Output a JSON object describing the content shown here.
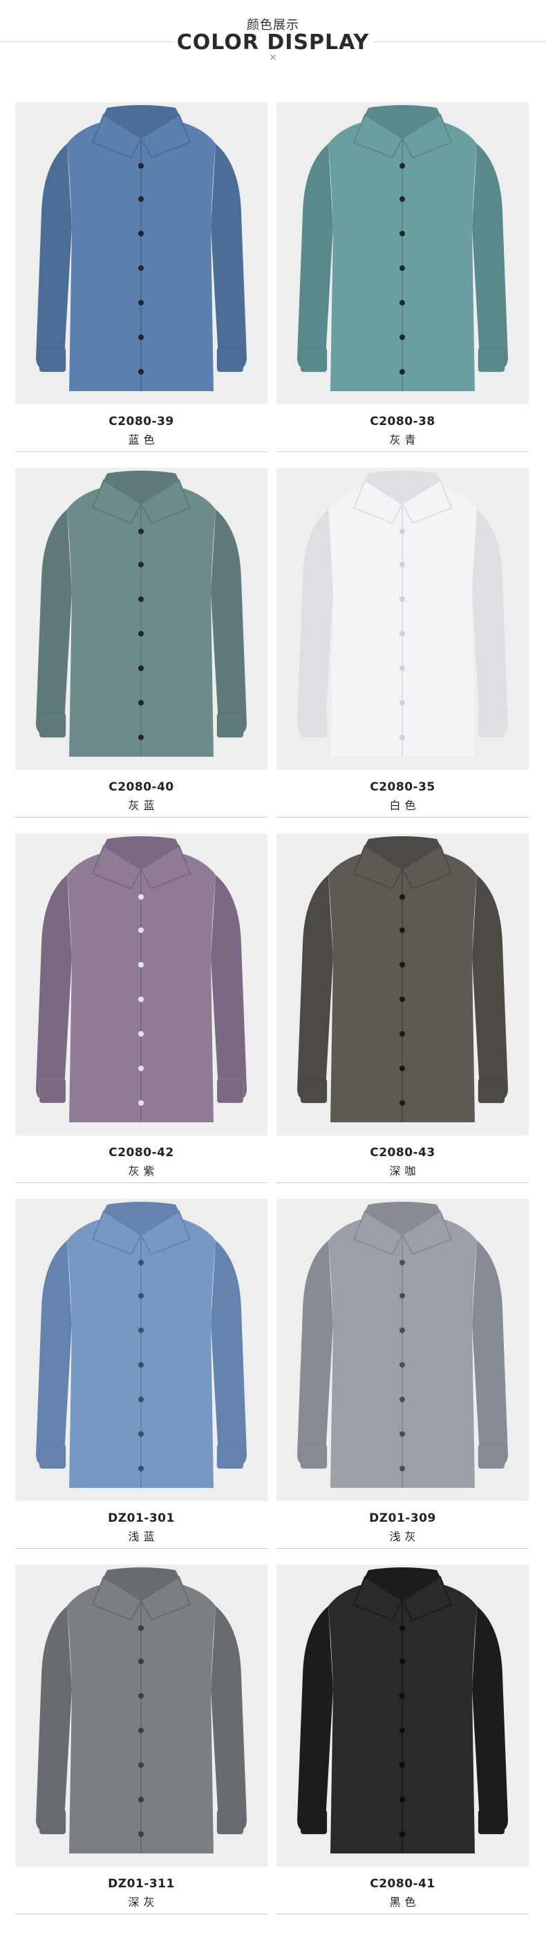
{
  "header": {
    "title_cn": "颜色展示",
    "title_en": "COLOR DISPLAY",
    "separator": "×"
  },
  "colors": [
    {
      "code": "C2080-39",
      "name": "蓝色",
      "fill": "#5b80ad",
      "shade": "#4b6d96",
      "button": "#1c2533"
    },
    {
      "code": "C2080-38",
      "name": "灰青",
      "fill": "#6a9ea1",
      "shade": "#5a898c",
      "button": "#1d2a2c"
    },
    {
      "code": "C2080-40",
      "name": "灰蓝",
      "fill": "#6e8b8c",
      "shade": "#5f7a7b",
      "button": "#1e2626"
    },
    {
      "code": "C2080-35",
      "name": "白色",
      "fill": "#f4f4f6",
      "shade": "#dedfe3",
      "button": "#d0d2d8"
    },
    {
      "code": "C2080-42",
      "name": "灰紫",
      "fill": "#8f7b96",
      "shade": "#7b6882",
      "button": "#e6e1e8"
    },
    {
      "code": "C2080-43",
      "name": "深咖",
      "fill": "#5e5953",
      "shade": "#4d4944",
      "button": "#1a1816"
    },
    {
      "code": "DZ01-301",
      "name": "浅蓝",
      "fill": "#7798c3",
      "shade": "#6484af",
      "button": "#3c4e67"
    },
    {
      "code": "DZ01-309",
      "name": "浅灰",
      "fill": "#9b9fa7",
      "shade": "#878b93",
      "button": "#4b4e55"
    },
    {
      "code": "DZ01-311",
      "name": "深灰",
      "fill": "#7b7f84",
      "shade": "#686c71",
      "button": "#3b3e42"
    },
    {
      "code": "C2080-41",
      "name": "黑色",
      "fill": "#2a2a2c",
      "shade": "#1c1c1e",
      "button": "#0c0c0d"
    }
  ],
  "background": "#eeeeee"
}
